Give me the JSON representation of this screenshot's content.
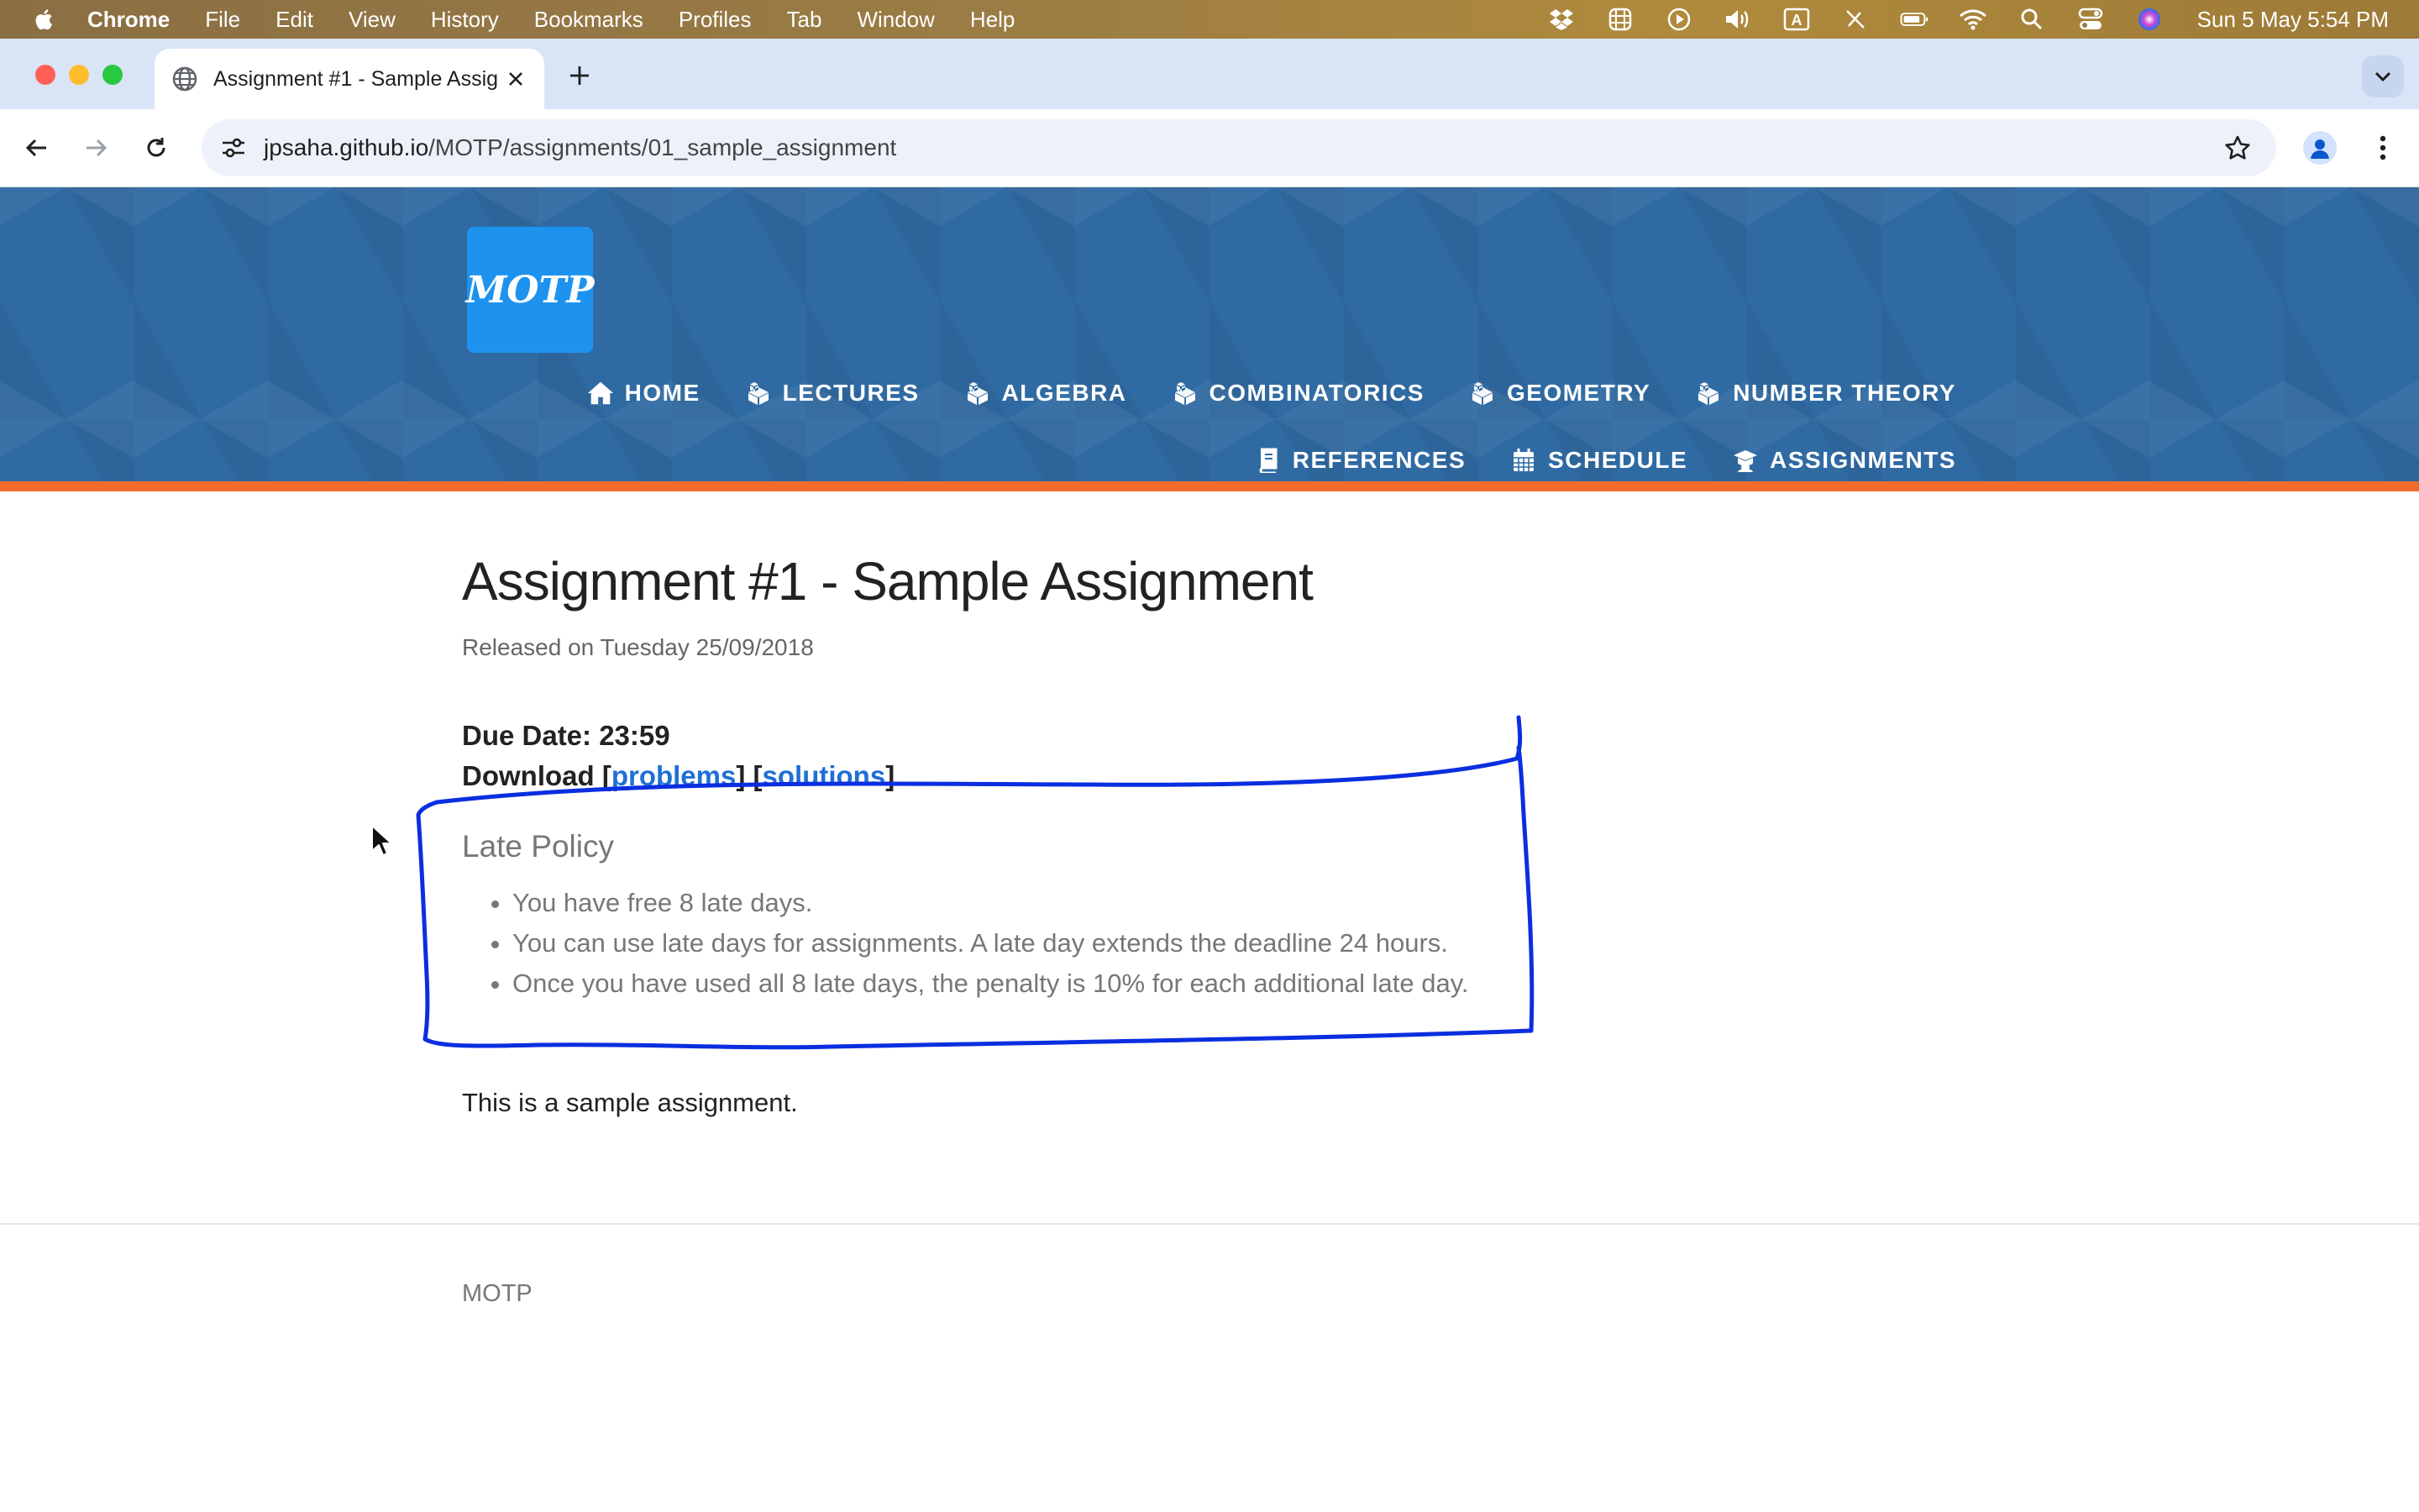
{
  "menubar": {
    "app_name": "Chrome",
    "items": [
      "File",
      "Edit",
      "View",
      "History",
      "Bookmarks",
      "Profiles",
      "Tab",
      "Window",
      "Help"
    ],
    "status_icons": [
      "dropbox-icon",
      "grid-app-icon",
      "play-icon",
      "volume-icon",
      "input-source-icon",
      "pen-off-icon",
      "battery-icon",
      "wifi-icon",
      "spotlight-icon",
      "control-center-icon",
      "siri-icon"
    ],
    "clock": "Sun 5 May  5:54 PM"
  },
  "browser": {
    "tab_title": "Assignment #1 - Sample Assignment",
    "url_domain": "jpsaha.github.io",
    "url_path": "/MOTP/assignments/01_sample_assignment"
  },
  "site": {
    "logo_text": "MOTP",
    "nav_row1": [
      {
        "label": "HOME",
        "icon": "home-icon"
      },
      {
        "label": "LECTURES",
        "icon": "cubes-icon"
      },
      {
        "label": "ALGEBRA",
        "icon": "cubes-icon"
      },
      {
        "label": "COMBINATORICS",
        "icon": "cubes-icon"
      },
      {
        "label": "GEOMETRY",
        "icon": "cubes-icon"
      },
      {
        "label": "NUMBER THEORY",
        "icon": "cubes-icon"
      }
    ],
    "nav_row2": [
      {
        "label": "REFERENCES",
        "icon": "book-icon"
      },
      {
        "label": "SCHEDULE",
        "icon": "calendar-icon"
      },
      {
        "label": "ASSIGNMENTS",
        "icon": "graduation-icon"
      }
    ],
    "accent_color": "#f26b2c",
    "header_color": "#2f6aa3"
  },
  "page": {
    "title": "Assignment #1 - Sample Assignment",
    "released": "Released on Tuesday 25/09/2018",
    "due": "Due Date: 23:59",
    "download_label": "Download ",
    "download_links": [
      "problems",
      "solutions"
    ],
    "late_policy_heading": "Late Policy",
    "late_policy_items": [
      "You have free 8 late days.",
      "You can use late days for assignments. A late day extends the deadline 24 hours.",
      "Once you have used all 8 late days, the penalty is 10% for each additional late day."
    ],
    "body_text": "This is a sample assignment."
  },
  "footer": {
    "text": "MOTP"
  },
  "annotation_color": "#0a2ee0"
}
